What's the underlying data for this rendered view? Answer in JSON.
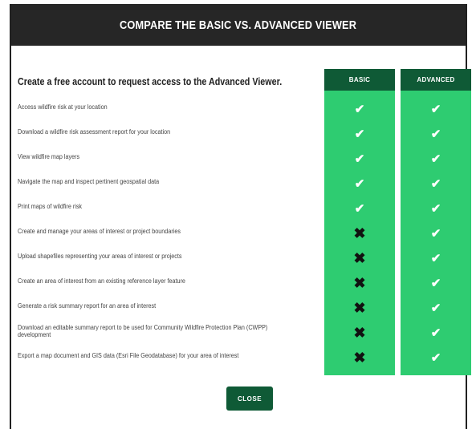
{
  "modal": {
    "title": "COMPARE THE BASIC VS. ADVANCED VIEWER",
    "intro": "Create a free account to request access to the Advanced Viewer.",
    "columns": {
      "basic": "BASIC",
      "advanced": "ADVANCED"
    },
    "close_label": "CLOSE",
    "colors": {
      "header_bg": "#262626",
      "column_green": "#2ecc71",
      "dark_green": "#0f5a36"
    },
    "features": [
      {
        "label": "Access wildfire risk at your location",
        "basic": "check-icon",
        "advanced": "check-icon"
      },
      {
        "label": "Download a wildfire risk assessment report for your location",
        "basic": "check-icon",
        "advanced": "check-icon"
      },
      {
        "label": "View wildfire map layers",
        "basic": "check-icon",
        "advanced": "check-icon"
      },
      {
        "label": "Navigate the map and inspect pertinent geospatial data",
        "basic": "check-icon",
        "advanced": "check-icon"
      },
      {
        "label": "Print maps of wildfire risk",
        "basic": "check-icon",
        "advanced": "check-icon"
      },
      {
        "label": "Create and manage your areas of interest or project boundaries",
        "basic": "cross-icon",
        "advanced": "check-icon"
      },
      {
        "label": "Upload shapefiles representing your areas of interest or projects",
        "basic": "cross-icon",
        "advanced": "check-icon"
      },
      {
        "label": "Create an area of interest from an existing reference layer feature",
        "basic": "cross-icon",
        "advanced": "check-icon"
      },
      {
        "label": "Generate a risk summary report for an area of interest",
        "basic": "cross-icon",
        "advanced": "check-icon"
      },
      {
        "label": "Download an editable summary report to be used for Community Wildfire Protection Plan (CWPP) development",
        "basic": "cross-icon",
        "advanced": "check-icon"
      },
      {
        "label": "Export a map document and GIS data (Esri File Geodatabase) for your area of interest",
        "basic": "cross-icon",
        "advanced": "check-icon"
      }
    ]
  }
}
